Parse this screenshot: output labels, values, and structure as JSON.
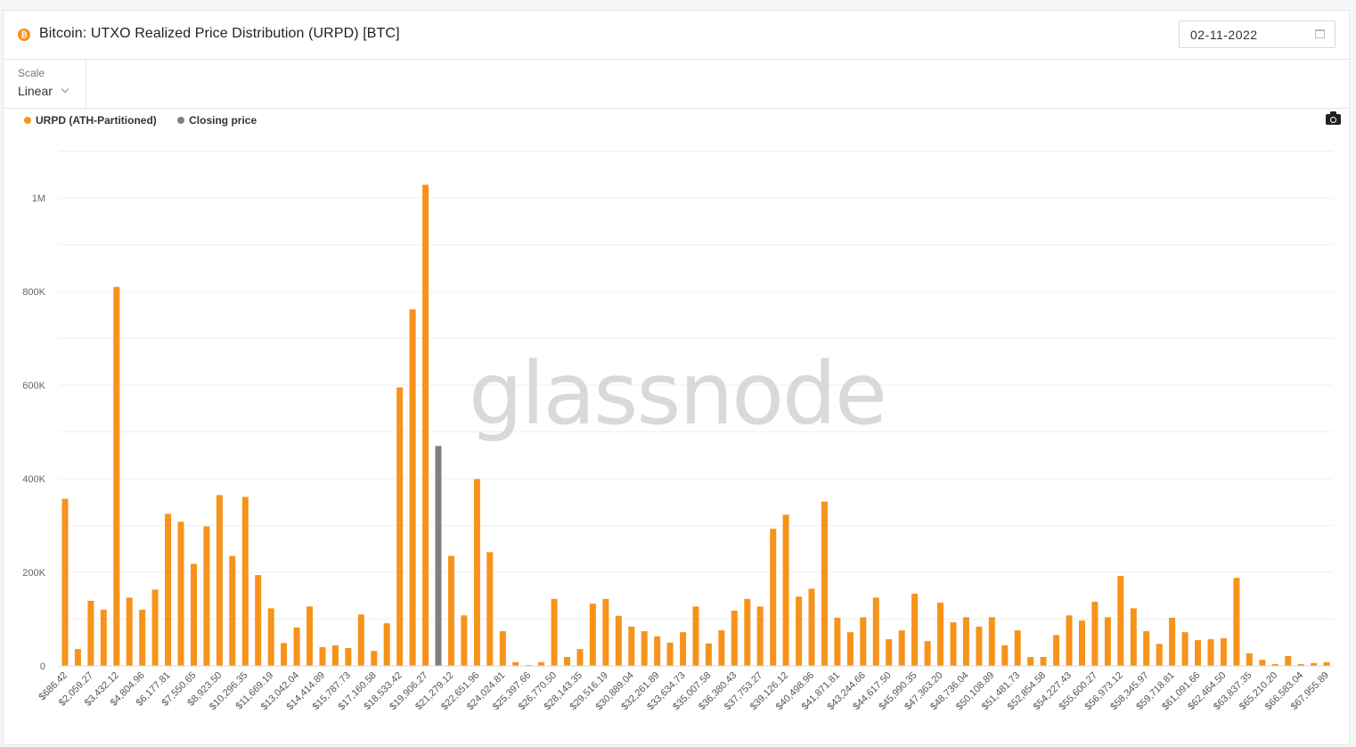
{
  "header": {
    "asset_icon": "bitcoin-icon",
    "title": "Bitcoin: UTXO Realized Price Distribution (URPD) [BTC]",
    "date": "02-11-2022",
    "date_icon": "calendar-icon"
  },
  "toolbar": {
    "scale_label": "Scale",
    "scale_value": "Linear"
  },
  "legend": [
    {
      "label": "URPD (ATH-Partitioned)",
      "color": "#f7931a"
    },
    {
      "label": "Closing price",
      "color": "#808080"
    }
  ],
  "watermark": "glassnode",
  "screenshot_icon": "camera-icon",
  "chart_data": {
    "type": "bar",
    "title": "Bitcoin: UTXO Realized Price Distribution (URPD) [BTC]",
    "xlabel": "",
    "ylabel": "",
    "ylim": [
      0,
      1100000
    ],
    "yticks": [
      {
        "value": 0,
        "label": "0"
      },
      {
        "value": 200000,
        "label": "200K"
      },
      {
        "value": 400000,
        "label": "400K"
      },
      {
        "value": 600000,
        "label": "600K"
      },
      {
        "value": 800000,
        "label": "800K"
      },
      {
        "value": 1000000,
        "label": "1M"
      }
    ],
    "grid": true,
    "legend_position": "top-left",
    "bar_step_usd": 686.42,
    "closing_price_index": 29,
    "xtick_labels": [
      "$686.42",
      "$2,059.27",
      "$3,432.12",
      "$4,804.96",
      "$6,177.81",
      "$7,550.65",
      "$8,923.50",
      "$10,296.35",
      "$11,669.19",
      "$13,042.04",
      "$14,414.89",
      "$15,787.73",
      "$17,160.58",
      "$18,533.42",
      "$19,906.27",
      "$21,279.12",
      "$22,651.96",
      "$24,024.81",
      "$25,397.66",
      "$26,770.50",
      "$28,143.35",
      "$29,516.19",
      "$30,889.04",
      "$32,261.89",
      "$33,634.73",
      "$35,007.58",
      "$36,380.43",
      "$37,753.27",
      "$39,126.12",
      "$40,498.96",
      "$41,871.81",
      "$43,244.66",
      "$44,617.50",
      "$45,990.35",
      "$47,363.20",
      "$48,736.04",
      "$50,108.89",
      "$51,481.73",
      "$52,854.58",
      "$54,227.43",
      "$55,600.27",
      "$56,973.12",
      "$58,345.97",
      "$59,718.81",
      "$61,091.66",
      "$62,464.50",
      "$63,837.35",
      "$65,210.20",
      "$66,583.04",
      "$67,955.89"
    ],
    "series": [
      {
        "name": "URPD (ATH-Partitioned)",
        "color": "#f7931a",
        "values": [
          357000,
          36000,
          139000,
          120000,
          810000,
          146000,
          120000,
          163000,
          325000,
          308000,
          218000,
          298000,
          365000,
          235000,
          361000,
          194000,
          123000,
          49000,
          82000,
          127000,
          40000,
          44000,
          38000,
          110000,
          32000,
          91000,
          595000,
          762000,
          1028000,
          470000,
          235000,
          108000,
          399000,
          243000,
          74000,
          8000,
          2000,
          8000,
          143000,
          19000,
          36000,
          133000,
          143000,
          107000,
          84000,
          74000,
          63000,
          50000,
          72000,
          127000,
          48000,
          76000,
          118000,
          143000,
          127000,
          293000,
          323000,
          148000,
          165000,
          351000,
          103000,
          72000,
          104000,
          146000,
          57000,
          76000,
          154000,
          53000,
          135000,
          93000,
          104000,
          84000,
          104000,
          44000,
          76000,
          19000,
          19000,
          66000,
          108000,
          97000,
          137000,
          104000,
          192000,
          123000,
          74000,
          47000,
          103000,
          72000,
          55000,
          57000,
          59000,
          188000,
          27000,
          13000,
          4000,
          21000,
          4000,
          6000,
          8000
        ]
      }
    ],
    "closing_price_color": "#808080"
  }
}
